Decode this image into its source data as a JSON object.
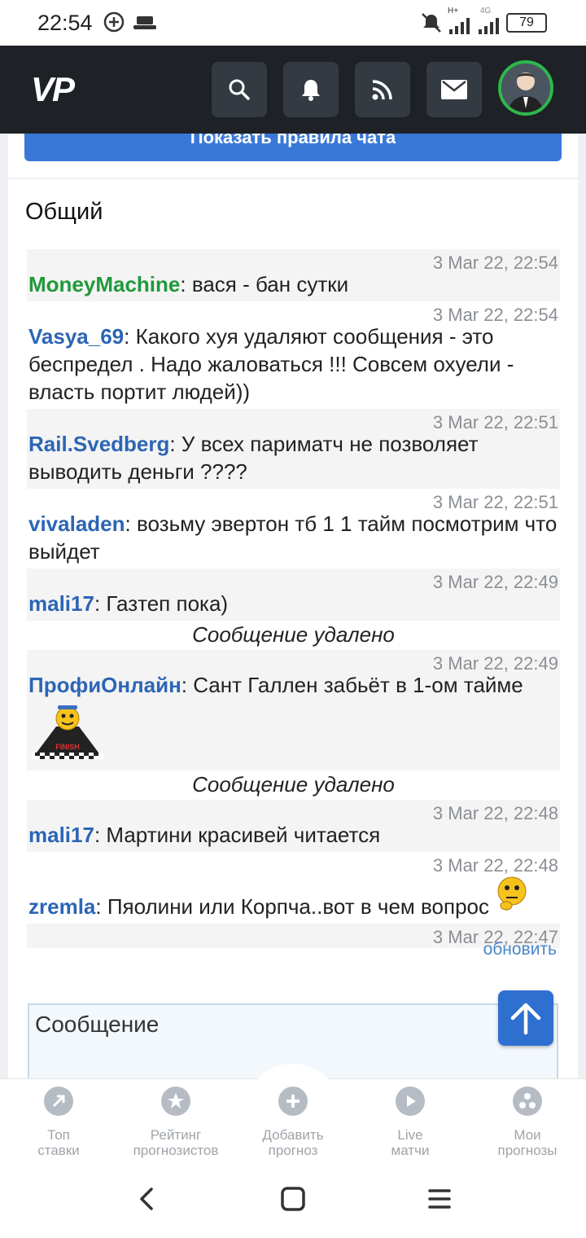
{
  "status_bar": {
    "time": "22:54",
    "network_label": "H+",
    "network_label2": "4G",
    "battery": "79"
  },
  "header": {
    "logo": "VP",
    "icons": [
      "search-icon",
      "bell-icon",
      "rss-icon",
      "mail-icon"
    ]
  },
  "rules_button_label": "Показать правила чата",
  "chat": {
    "title": "Общий",
    "messages": [
      {
        "time": "3 Mar 22, 22:54",
        "author": "MoneyMachine",
        "text": ": вася - бан сутки"
      },
      {
        "time": "3 Mar 22, 22:54",
        "author": "Vasya_69",
        "text": ": Какого хуя удаляют сообщения - это беспредел . Надо жаловаться !!! Совсем охуели - власть портит людей))"
      },
      {
        "time": "3 Mar 22, 22:51",
        "author": "Rail.Svedberg",
        "text": ": У всех париматч не позволяет выводить деньги ????"
      },
      {
        "time": "3 Mar 22, 22:51",
        "author": "vivaladen",
        "text": ": возьму эвертон тб 1 1 тайм посмотрим что выйдет"
      },
      {
        "time": "3 Mar 22, 22:49",
        "author": "mali17",
        "text": ": Газтеп пока)"
      },
      {
        "time": "3 Mar 22, 22:49",
        "author": "ПрофиОнлайн",
        "text": ": Сант Галлен забьёт в 1-ом тайме"
      },
      {
        "time": "3 Mar 22, 22:48",
        "author": "mali17",
        "text": ": Мартини красивей читается"
      },
      {
        "time": "3 Mar 22, 22:48",
        "author": "zremla",
        "text": ": Пяолини или Корпча..вот в чем вопрос"
      },
      {
        "time": "3 Mar 22, 22:47"
      }
    ],
    "deleted_label": "Сообщение удалено",
    "refresh_link": "обновить",
    "smiley_text": "FINISH",
    "input_placeholder": "Сообщение"
  },
  "bottom_nav": {
    "items": [
      {
        "line1": "Топ",
        "line2": "ставки",
        "icon": "arrow-icon"
      },
      {
        "line1": "Рейтинг",
        "line2": "прогнозистов",
        "icon": "star-icon"
      },
      {
        "line1": "Добавить",
        "line2": "прогноз",
        "icon": "plus-icon"
      },
      {
        "line1": "Live",
        "line2": "матчи",
        "icon": "play-icon"
      },
      {
        "line1": "Мои",
        "line2": "прогнозы",
        "icon": "dots-icon"
      }
    ]
  },
  "colors": {
    "accent_blue": "#3a78d8",
    "author_green": "#1f9a3b",
    "author_blue": "#2c65b5",
    "header_bg": "#1e2227"
  }
}
